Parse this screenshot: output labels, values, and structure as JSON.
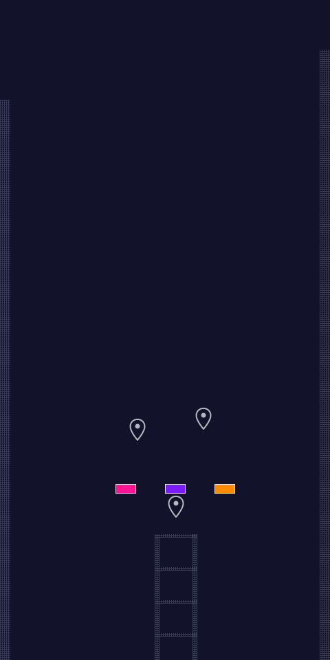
{
  "scene": {
    "background": "#12132a",
    "wall_color": "#3a3d56"
  },
  "pads": [
    {
      "name": "pink-pad",
      "color": "#ff1493"
    },
    {
      "name": "purple-pad",
      "color": "#7a1cff"
    },
    {
      "name": "orange-pad",
      "color": "#ff8c00"
    }
  ],
  "markers": [
    {
      "name": "marker-pin-left",
      "icon": "map-pin-icon",
      "color": "#b8b8c0"
    },
    {
      "name": "marker-pin-right",
      "icon": "map-pin-icon",
      "color": "#b8b8c0"
    },
    {
      "name": "marker-pin-center",
      "icon": "map-pin-icon",
      "color": "#b8b8c0"
    }
  ]
}
